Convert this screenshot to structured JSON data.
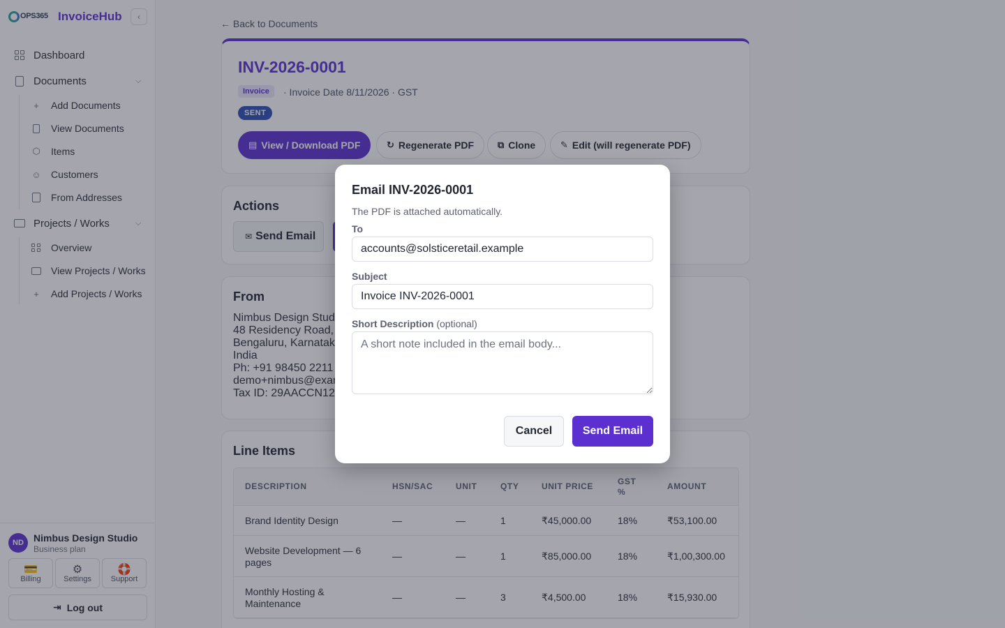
{
  "brand": {
    "logo_text": "OPS365",
    "name": "InvoiceHub",
    "collapse_glyph": "‹"
  },
  "sidebar": {
    "dashboard": "Dashboard",
    "documents": "Documents",
    "documents_sub": [
      "Add Documents",
      "View Documents",
      "Items",
      "Customers",
      "From Addresses"
    ],
    "projects": "Projects / Works",
    "projects_sub": [
      "Overview",
      "View Projects / Works",
      "Add Projects / Works"
    ]
  },
  "account": {
    "initials": "ND",
    "name": "Nimbus Design Studio",
    "plan": "Business plan"
  },
  "footer_buttons": {
    "billing": "Billing",
    "settings": "Settings",
    "support": "Support",
    "logout": "Log out"
  },
  "page": {
    "back": "← Back to Documents",
    "invoice_number": "INV-2026-0001",
    "type": "Invoice",
    "meta": "· Invoice Date 8/11/2026 · GST",
    "status": "SENT",
    "buttons": {
      "view_pdf": "View / Download PDF",
      "regenerate": "Regenerate PDF",
      "clone": "Clone",
      "edit": "Edit (will regenerate PDF)"
    }
  },
  "actions": {
    "title": "Actions",
    "send_email": "Send Email"
  },
  "from": {
    "title": "From",
    "lines": [
      "Nimbus Design Stud",
      "48 Residency Road,",
      "Bengaluru, Karnatak",
      "India",
      "Ph: +91 98450 2211",
      "demo+nimbus@exan",
      "Tax ID: 29AACCN123"
    ]
  },
  "line_items": {
    "title": "Line Items",
    "columns": [
      "DESCRIPTION",
      "HSN/SAC",
      "UNIT",
      "QTY",
      "UNIT PRICE",
      "GST %",
      "AMOUNT"
    ],
    "rows": [
      [
        "Brand Identity Design",
        "—",
        "—",
        "1",
        "₹45,000.00",
        "18%",
        "₹53,100.00"
      ],
      [
        "Website Development — 6 pages",
        "—",
        "—",
        "1",
        "₹85,000.00",
        "18%",
        "₹1,00,300.00"
      ],
      [
        "Monthly Hosting & Maintenance",
        "—",
        "—",
        "3",
        "₹4,500.00",
        "18%",
        "₹15,930.00"
      ]
    ]
  },
  "modal": {
    "title": "Email INV-2026-0001",
    "note": "The PDF is attached automatically.",
    "to_label": "To",
    "to_value": "accounts@solsticeretail.example",
    "subject_label": "Subject",
    "subject_value": "Invoice INV-2026-0001",
    "desc_label": "Short Description",
    "desc_optional": "(optional)",
    "desc_placeholder": "A short note included in the email body...",
    "cancel": "Cancel",
    "send": "Send Email"
  },
  "colors": {
    "accent": "#5b2fd0",
    "status_sent": "#2b4fb3"
  }
}
